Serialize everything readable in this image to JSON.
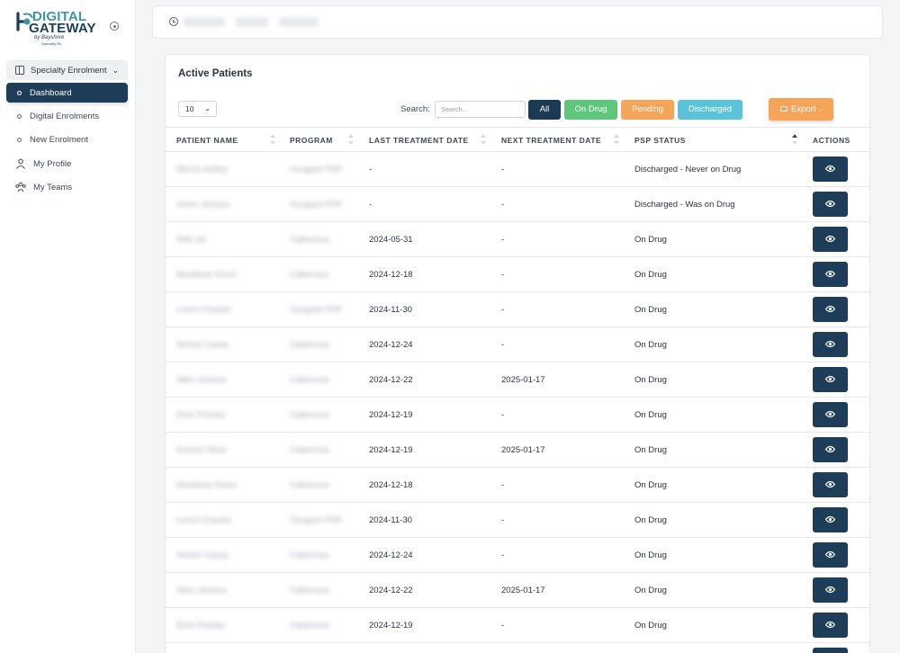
{
  "brand": {
    "line1": "DIGITAL",
    "line2": "GATEWAY",
    "by": "by Bayshore",
    "sub": "Specialty Rx"
  },
  "sidebar": {
    "group_label": "Specialty Enrolment",
    "items": [
      {
        "label": "Dashboard",
        "active": true
      },
      {
        "label": "Digital Enrolments",
        "active": false
      },
      {
        "label": "New Enrolment",
        "active": false
      }
    ],
    "profile_label": "My Profile",
    "teams_label": "My Teams"
  },
  "card": {
    "title": "Active Patients",
    "page_length": "10",
    "search_label": "Search:",
    "search_placeholder": "Search..",
    "filters": {
      "all": "All",
      "on_drug": "On Drug",
      "pending": "Pending",
      "discharged": "Discharged"
    },
    "export_label": "Export"
  },
  "table": {
    "headers": [
      "PATIENT NAME",
      "PROGRAM",
      "LAST TREATMENT DATE",
      "NEXT TREATMENT DATE",
      "PSP STATUS",
      "ACTIONS"
    ],
    "rows": [
      {
        "name": "Morris Ashley",
        "program": "Ocugard PSP",
        "last": "-",
        "next": "-",
        "status": "Discharged - Never on Drug"
      },
      {
        "name": "Amen Jessica",
        "program": "Ocugard PSP",
        "last": "-",
        "next": "-",
        "status": "Discharged - Was on Drug"
      },
      {
        "name": "With ed",
        "program": "Cabenuva",
        "last": "2024-05-31",
        "next": "-",
        "status": "On Drug"
      },
      {
        "name": "Meadows Kevin",
        "program": "Cabenuva",
        "last": "2024-12-18",
        "next": "-",
        "status": "On Drug"
      },
      {
        "name": "Lunch Charles",
        "program": "Ocugard PSP",
        "last": "2024-11-30",
        "next": "-",
        "status": "On Drug"
      },
      {
        "name": "Norton Casey",
        "program": "Cabenuva",
        "last": "2024-12-24",
        "next": "-",
        "status": "On Drug"
      },
      {
        "name": "Allen Jessica",
        "program": "Cabenuva",
        "last": "2024-12-22",
        "next": "2025-01-17",
        "status": "On Drug"
      },
      {
        "name": "Elvis Presley",
        "program": "Cabenuva",
        "last": "2024-12-19",
        "next": "-",
        "status": "On Drug"
      },
      {
        "name": "Acosta Olivia",
        "program": "Cabenuva",
        "last": "2024-12-19",
        "next": "2025-01-17",
        "status": "On Drug"
      },
      {
        "name": "Meadows Kevin",
        "program": "Cabenuva",
        "last": "2024-12-18",
        "next": "-",
        "status": "On Drug"
      },
      {
        "name": "Lunch Charles",
        "program": "Ocugard PSP",
        "last": "2024-11-30",
        "next": "-",
        "status": "On Drug"
      },
      {
        "name": "Norton Casey",
        "program": "Cabenuva",
        "last": "2024-12-24",
        "next": "-",
        "status": "On Drug"
      },
      {
        "name": "Allen Jessica",
        "program": "Cabenuva",
        "last": "2024-12-22",
        "next": "2025-01-17",
        "status": "On Drug"
      },
      {
        "name": "Elvis Presley",
        "program": "Cabenuva",
        "last": "2024-12-19",
        "next": "-",
        "status": "On Drug"
      },
      {
        "name": "",
        "program": "",
        "last": "",
        "next": "",
        "status": ""
      }
    ]
  },
  "colors": {
    "primary": "#1e3d59",
    "on_drug": "#5ec77b",
    "pending": "#f4a55a",
    "discharged": "#5bc3d9",
    "brand_teal": "#3b97a0"
  }
}
